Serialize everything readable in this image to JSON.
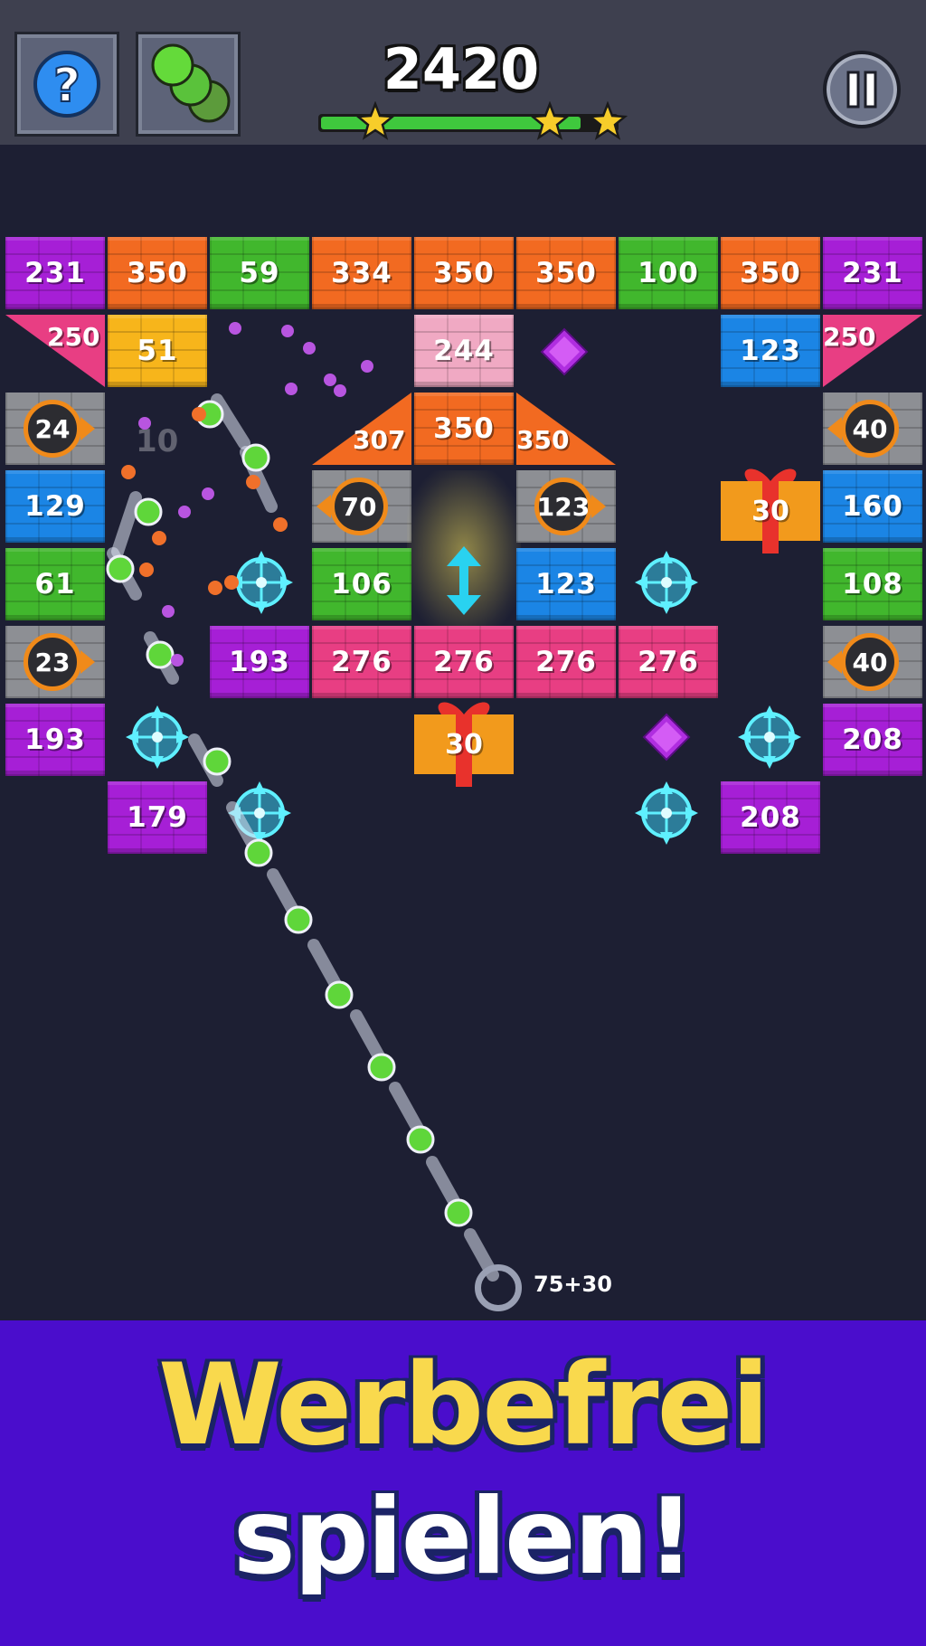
{
  "score": "2420",
  "progress": 0.88,
  "stars": 3,
  "launcher": {
    "ball_count": "75+30"
  },
  "faded_number": "10",
  "promo": {
    "line1": "Werbefrei",
    "line2": "spielen!"
  },
  "colors": {
    "purple": "#a61fd6",
    "orange": "#f26a21",
    "green": "#41b72d",
    "pink": "#e83e83",
    "light_pink": "#f0a9c3",
    "blue": "#1b85e5",
    "yellow_hit": "#f7b51b"
  },
  "bricks": {
    "row1": [
      "231",
      "350",
      "59",
      "334",
      "350",
      "350",
      "100",
      "350",
      "231"
    ],
    "row2_left_triangle": "250",
    "row2_hit": "51",
    "row2_mid": "244",
    "row2_right": "123",
    "row2_right_triangle": "250",
    "row3_bomb_left": "24",
    "row3_slope_left": "307",
    "row3_mid": "350",
    "row3_slope_right": "350",
    "row3_bomb_right": "40",
    "row4_left": "129",
    "row4_bomb_a": "70",
    "row4_bomb_b": "123",
    "row4_gift": "30",
    "row4_right": "160",
    "row5_left": "61",
    "row5_mid": "106",
    "row5_blue": "123",
    "row5_right": "108",
    "row6_bomb_left": "23",
    "row6": [
      "193",
      "276",
      "276",
      "276",
      "276"
    ],
    "row6_bomb_right": "40",
    "row7_left": "193",
    "row7_gift": "30",
    "row7_right": "208",
    "row8_left": "179",
    "row8_right": "208"
  },
  "icons": {
    "help": "question-mark",
    "balls": "green-balls",
    "pause": "pause",
    "star": "star",
    "crosshair": "crosshair",
    "gem": "purple-gem",
    "gift": "gift"
  }
}
